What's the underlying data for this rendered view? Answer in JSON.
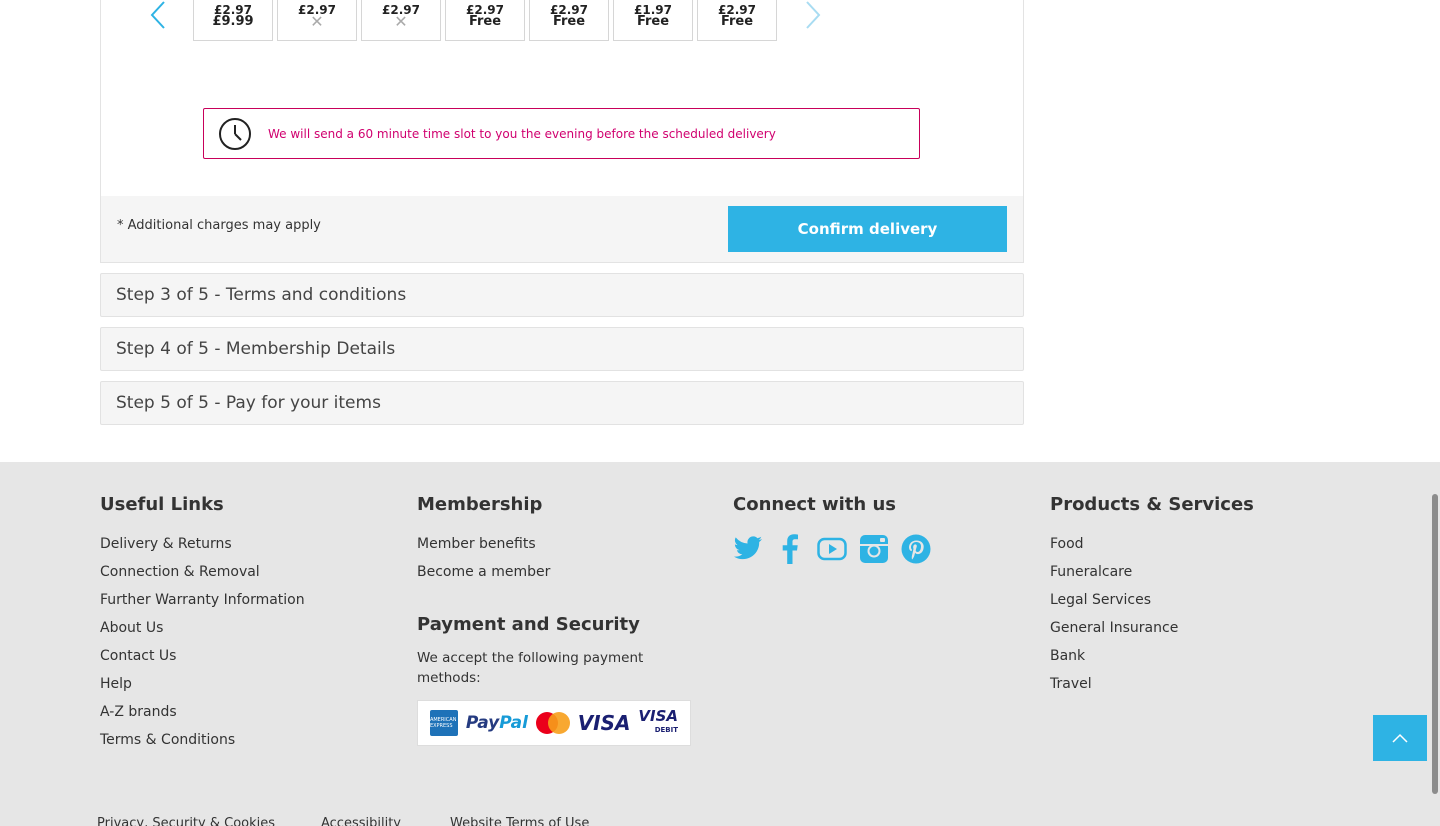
{
  "slots": [
    {
      "top": "£2.97",
      "price": "£9.99",
      "available": true
    },
    {
      "top": "£2.97",
      "price": "",
      "available": false
    },
    {
      "top": "£2.97",
      "price": "",
      "available": false
    },
    {
      "top": "£2.97",
      "price": "Free",
      "available": true
    },
    {
      "top": "£2.97",
      "price": "Free",
      "available": true
    },
    {
      "top": "£1.97",
      "price": "Free",
      "available": true
    },
    {
      "top": "£2.97",
      "price": "Free",
      "available": true
    }
  ],
  "notice": {
    "text": "We will send a 60 minute time slot to you the evening before the scheduled delivery"
  },
  "checkout": {
    "note": "* Additional charges may apply",
    "confirm_label": "Confirm delivery"
  },
  "steps": [
    {
      "label": "Step 3 of 5 - Terms and conditions"
    },
    {
      "label": "Step 4 of 5 - Membership Details"
    },
    {
      "label": "Step 5 of 5 - Pay for your items"
    }
  ],
  "footer": {
    "useful_links": {
      "title": "Useful Links",
      "items": [
        "Delivery & Returns",
        "Connection & Removal",
        "Further Warranty Information",
        "About Us",
        "Contact Us",
        "Help",
        "A-Z brands",
        "Terms & Conditions"
      ]
    },
    "membership": {
      "title": "Membership",
      "items": [
        "Member benefits",
        "Become a member"
      ]
    },
    "payment": {
      "title": "Payment and Security",
      "text": "We accept the following payment methods:",
      "cards": [
        "amex-icon",
        "paypal-icon",
        "mastercard-icon",
        "visa-icon",
        "visa-debit-icon"
      ],
      "paypal_a": "Pay",
      "paypal_b": "Pal",
      "visa": "VISA",
      "visa_debit": "VISA",
      "debit": "DEBIT",
      "amex": "AMERICAN EXPRESS"
    },
    "connect": {
      "title": "Connect with us",
      "icons": [
        "twitter-icon",
        "facebook-icon",
        "youtube-icon",
        "instagram-icon",
        "pinterest-icon"
      ]
    },
    "products": {
      "title": "Products & Services",
      "items": [
        "Food",
        "Funeralcare",
        "Legal Services",
        "General Insurance",
        "Bank",
        "Travel"
      ]
    },
    "legal": [
      "Privacy, Security & Cookies",
      "Accessibility",
      "Website Terms of Use"
    ]
  },
  "colors": {
    "accent": "#2eb3e4",
    "notice": "#d0006f",
    "footer_bg": "#e6e6e6"
  }
}
